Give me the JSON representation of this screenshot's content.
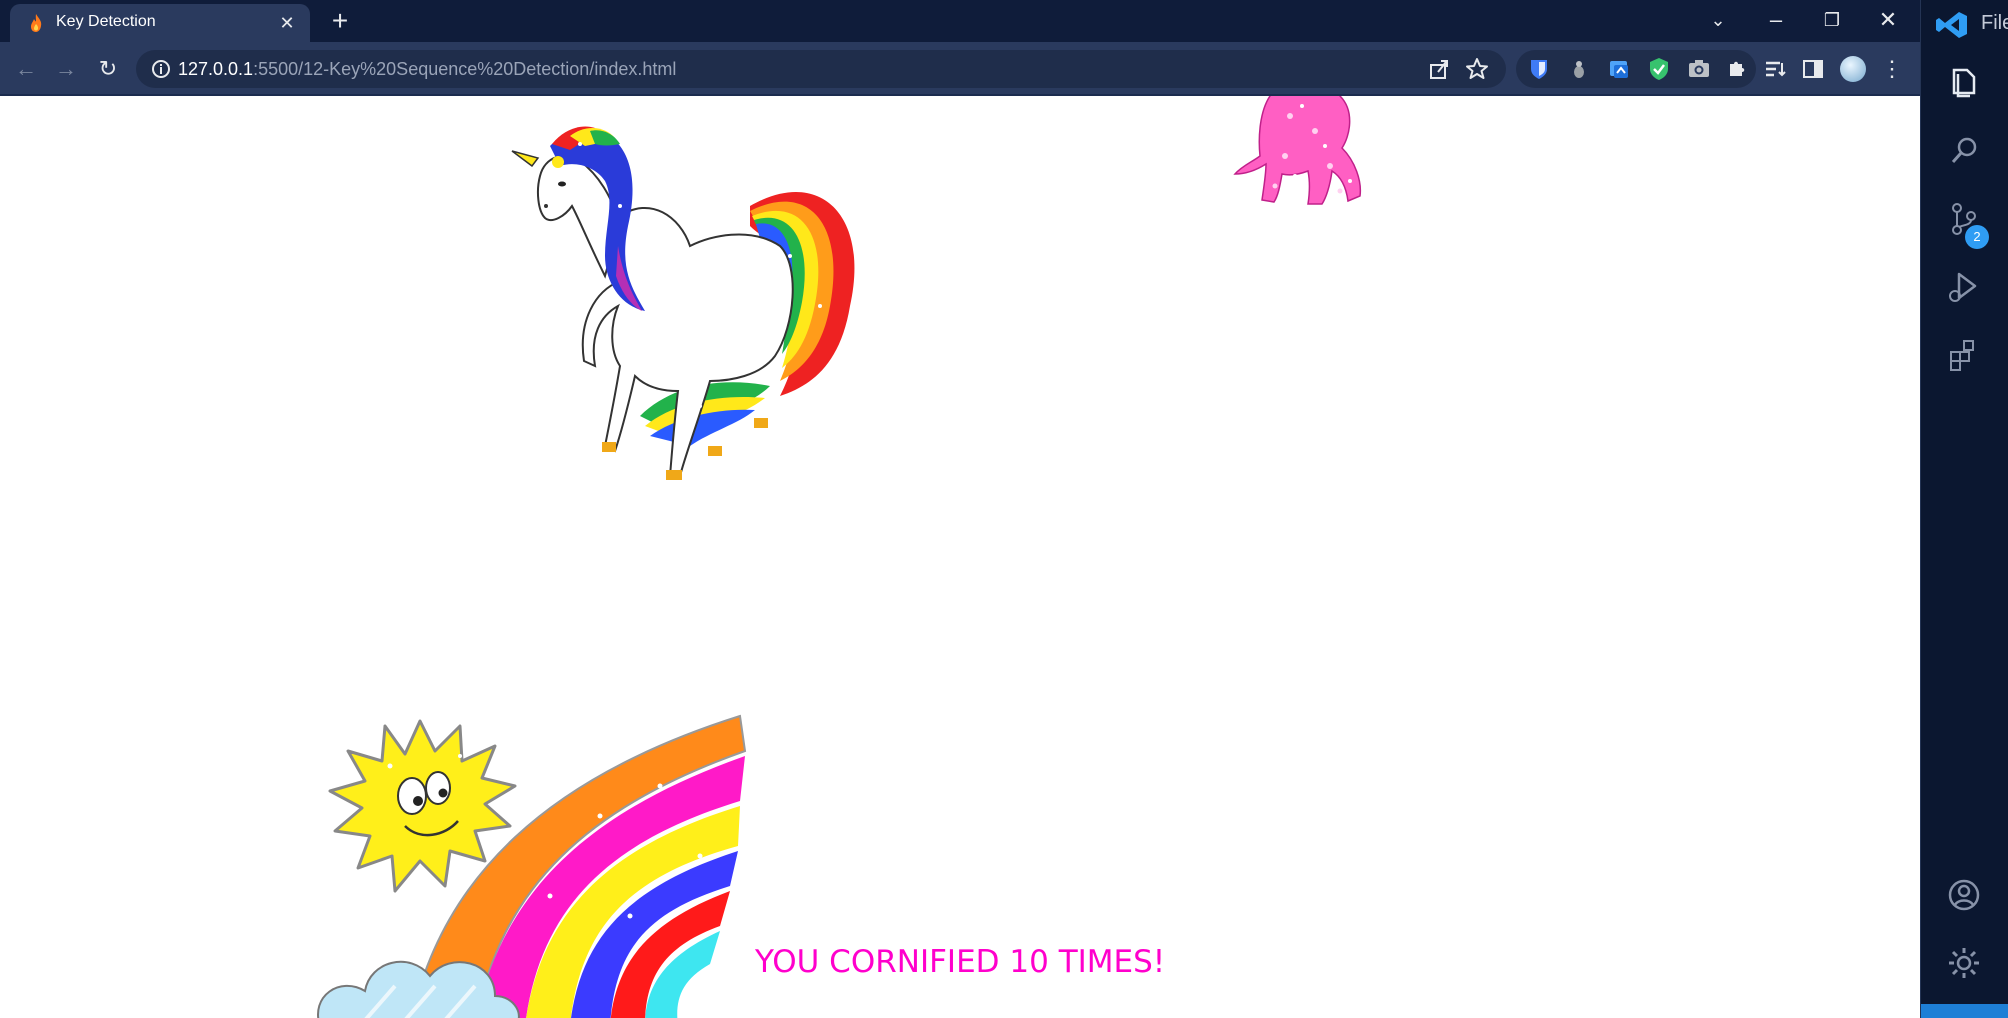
{
  "browser": {
    "tab": {
      "title": "Key Detection",
      "favicon": "flame-icon",
      "close_icon": "close-icon"
    },
    "new_tab_icon": "plus-icon",
    "window_controls": {
      "tab_search_icon": "chevron-down-icon",
      "minimize": "minimize-icon",
      "restore": "restore-icon",
      "close": "close-icon"
    },
    "toolbar": {
      "back_icon": "arrow-left-icon",
      "forward_icon": "arrow-right-icon",
      "reload_icon": "reload-icon",
      "url_host": "127.0.0.1",
      "url_rest": ":5500/12-Key%20Sequence%20Detection/index.html",
      "site_info_icon": "info-icon",
      "share_icon": "share-icon",
      "bookmark_icon": "star-icon",
      "extensions": [
        "bitwarden-icon",
        "ext-gray-icon",
        "translate-icon",
        "shield-check-icon",
        "camera-icon",
        "puzzle-icon"
      ],
      "reading_list_icon": "reading-list-icon",
      "side_panel_icon": "side-panel-icon",
      "profile_icon": "avatar-icon",
      "menu_icon": "kebab-menu-icon"
    }
  },
  "page": {
    "counter_text": "YOU CORNIFIED 10 TIMES!",
    "counter_color": "#ff00cc"
  },
  "vscode": {
    "menu_label": "File",
    "activity": [
      "explorer-icon",
      "search-icon",
      "source-control-icon",
      "run-debug-icon",
      "extensions-icon"
    ],
    "scm_badge": "2",
    "bottom": [
      "account-icon",
      "gear-icon"
    ]
  }
}
